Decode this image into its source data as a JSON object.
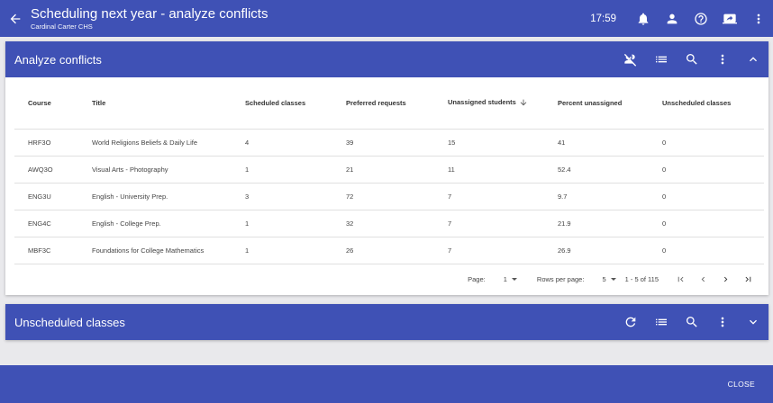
{
  "header": {
    "title": "Scheduling next year - analyze conflicts",
    "subtitle": "Cardinal Carter CHS",
    "time": "17:59"
  },
  "analyze": {
    "title": "Analyze conflicts",
    "columns": [
      "Course",
      "Title",
      "Scheduled classes",
      "Preferred requests",
      "Unassigned students",
      "Percent unassigned",
      "Unscheduled classes"
    ],
    "rows": [
      [
        "HRF3O",
        "World Religions Beliefs & Daily Life",
        "4",
        "39",
        "15",
        "41",
        "0"
      ],
      [
        "AWQ3O",
        "Visual Arts - Photography",
        "1",
        "21",
        "11",
        "52.4",
        "0"
      ],
      [
        "ENG3U",
        "English - University Prep.",
        "3",
        "72",
        "7",
        "9.7",
        "0"
      ],
      [
        "ENG4C",
        "English - College Prep.",
        "1",
        "32",
        "7",
        "21.9",
        "0"
      ],
      [
        "MBF3C",
        "Foundations for College Mathematics",
        "1",
        "26",
        "7",
        "26.9",
        "0"
      ]
    ],
    "pager": {
      "page_label": "Page:",
      "page": "1",
      "rows_label": "Rows per page:",
      "rows_per_page": "5",
      "range": "1 - 5 of 115"
    }
  },
  "unscheduled": {
    "title": "Unscheduled classes"
  },
  "footer": {
    "close": "CLOSE"
  },
  "colors": {
    "primary": "#3f51b5",
    "background": "#e9e9ec"
  }
}
